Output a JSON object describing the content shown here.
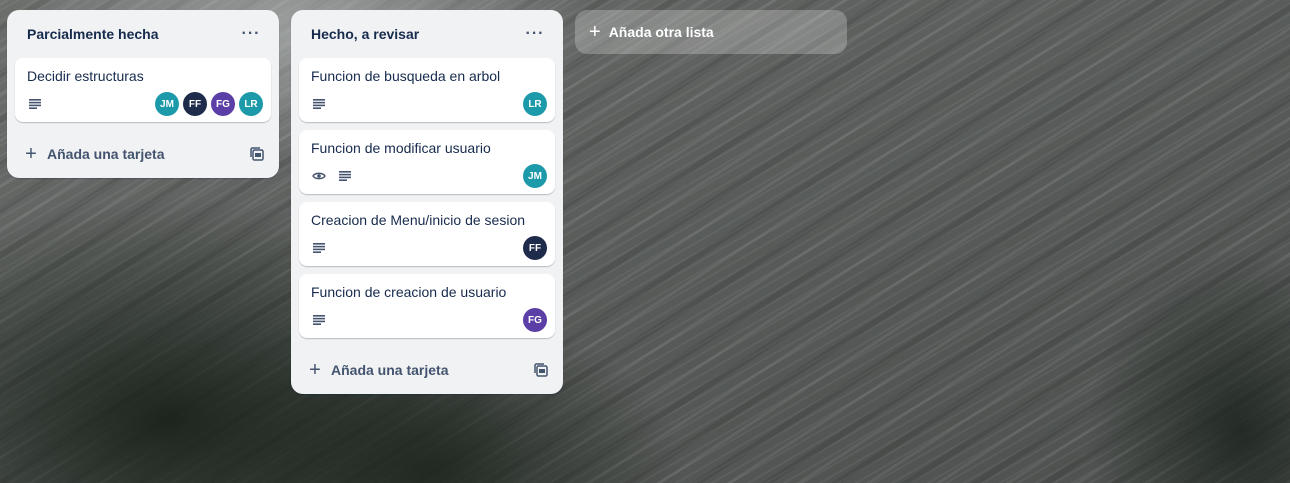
{
  "lists": [
    {
      "title": "Parcialmente hecha",
      "more_label": "···",
      "add_card_label": "Añada una tarjeta",
      "cards": [
        {
          "title": "Decidir estructuras",
          "badges": [
            "description-icon"
          ],
          "members": [
            {
              "initials": "JM",
              "color": "#1d9aaa"
            },
            {
              "initials": "FF",
              "color": "#1f2b4a"
            },
            {
              "initials": "FG",
              "color": "#5b3fa6"
            },
            {
              "initials": "LR",
              "color": "#1d9aaa"
            }
          ]
        }
      ]
    },
    {
      "title": "Hecho, a revisar",
      "more_label": "···",
      "add_card_label": "Añada una tarjeta",
      "cards": [
        {
          "title": "Funcion de busqueda en arbol",
          "badges": [
            "description-icon"
          ],
          "members": [
            {
              "initials": "LR",
              "color": "#1d9aaa"
            }
          ]
        },
        {
          "title": "Funcion de modificar usuario",
          "badges": [
            "eye-icon",
            "description-icon"
          ],
          "members": [
            {
              "initials": "JM",
              "color": "#1d9aaa"
            }
          ]
        },
        {
          "title": "Creacion de Menu/inicio de sesion",
          "badges": [
            "description-icon"
          ],
          "members": [
            {
              "initials": "FF",
              "color": "#1f2b4a"
            }
          ]
        },
        {
          "title": "Funcion de creacion de usuario",
          "badges": [
            "description-icon"
          ],
          "members": [
            {
              "initials": "FG",
              "color": "#5b3fa6"
            }
          ]
        }
      ]
    }
  ],
  "add_list": {
    "label": "Añada otra lista"
  }
}
